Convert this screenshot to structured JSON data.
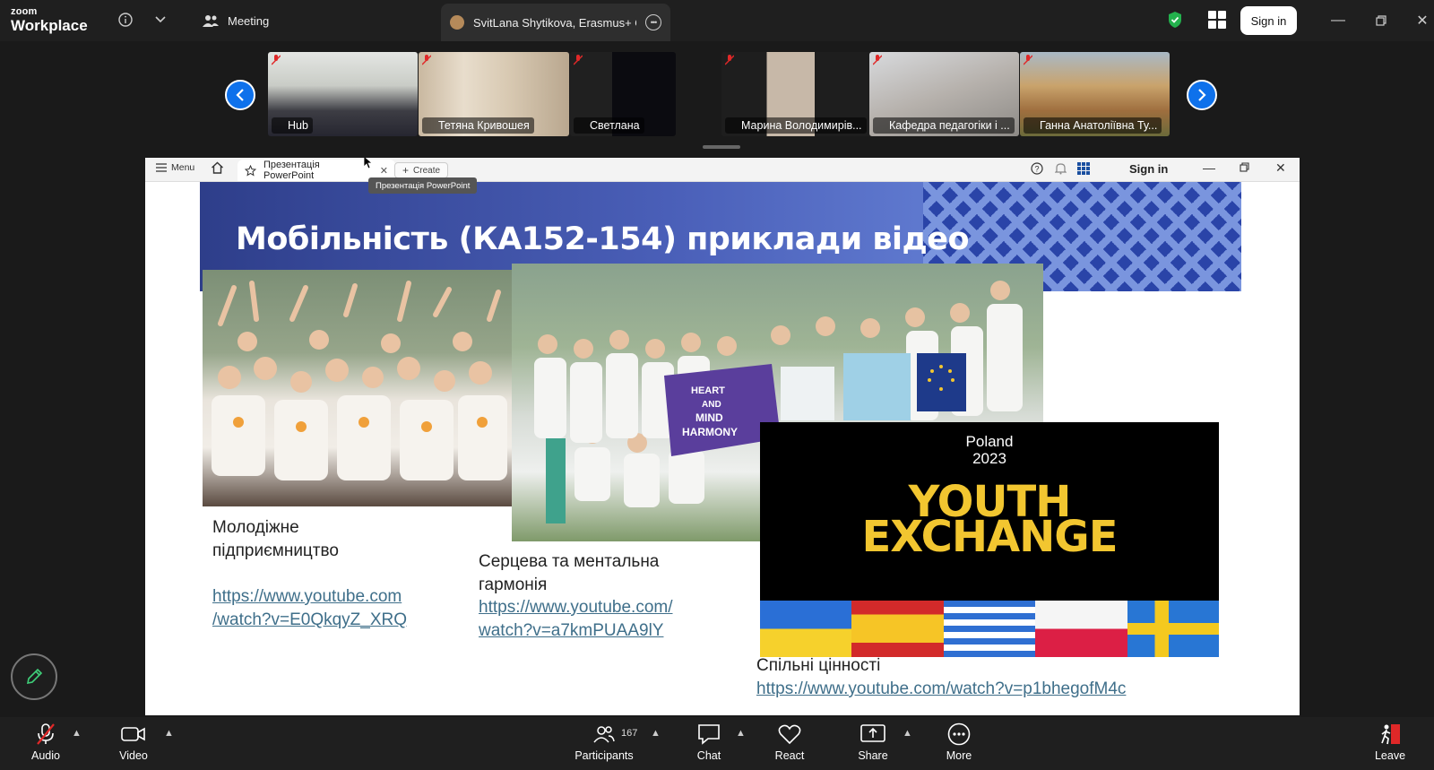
{
  "app": {
    "logo_top": "zoom",
    "logo_bottom": "Workplace",
    "meeting_tab_label": "Meeting",
    "active_tab_title": "SvitLana Shytikova, Erasmus+ Offi",
    "sign_in_label": "Sign in"
  },
  "participants": [
    {
      "name": "Hub"
    },
    {
      "name": "Тетяна Кривошея"
    },
    {
      "name": "Светлана"
    },
    {
      "name": "Марина Володимирів..."
    },
    {
      "name": "Кафедра педагогіки і ..."
    },
    {
      "name": "Ганна Анатоліївна Ту..."
    }
  ],
  "browser": {
    "menu_label": "Menu",
    "tab_title": "Презентація PowerPoint",
    "create_label": "Create",
    "tooltip": "Презентація PowerPoint",
    "sign_in_label": "Sign in"
  },
  "slide": {
    "title": "Мобільність (КА152-154) приклади відео",
    "item1_caption_line1": "Молодіжне",
    "item1_caption_line2": "підприємництво",
    "item1_link_line1": "https://www.youtube.com",
    "item1_link_line2": "/watch?v=E0QkqyZ_XRQ",
    "item2_caption_line1": "Серцева та ментальна",
    "item2_caption_line2": "гармонія",
    "item2_link_line1": "https://www.youtube.com/",
    "item2_link_line2": "watch?v=a7kmPUAA9lY",
    "item3_caption": "Спільні цінності",
    "item3_link": "https://www.youtube.com/watch?v=p1bhegofM4c",
    "banner_line1": "HEART",
    "banner_line2": "AND",
    "banner_line3": "MIND",
    "banner_line4": "HARMONY",
    "card_country": "Poland",
    "card_year": "2023",
    "card_word1": "YOUTH",
    "card_word2": "EXCHANGE"
  },
  "toolbar": {
    "audio": "Audio",
    "video": "Video",
    "participants": "Participants",
    "participants_count": "167",
    "chat": "Chat",
    "react": "React",
    "share": "Share",
    "more": "More",
    "leave": "Leave"
  },
  "colors": {
    "accent_blue": "#0e71eb",
    "link_color": "#3f6f8a",
    "youth_exchange_yellow": "#f2c630",
    "leave_red": "#e02828"
  }
}
